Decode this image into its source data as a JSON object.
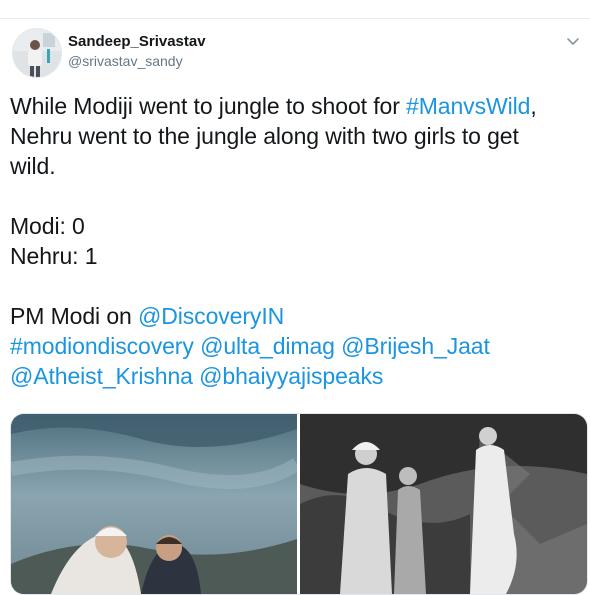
{
  "tweet": {
    "author": {
      "display_name": "Sandeep_Srivastav",
      "handle": "@srivastav_sandy"
    },
    "text": {
      "line1_plain": "While Modiji went to jungle to shoot for ",
      "line1_link": "#ManvsWild",
      "line1_end": ",",
      "line2": "Nehru went to the jungle along with two girls to get",
      "line3": "wild.",
      "line4": "Modi: 0",
      "line5": "Nehru: 1",
      "line6_plain": "PM Modi on ",
      "line6_link": "@DiscoveryIN",
      "line7_link1": "#modiondiscovery",
      "line7_link2": "@ulta_dimag",
      "line7_link3": "@Brijesh_Jaat",
      "line8_link1": "@Atheist_Krishna",
      "line8_link2": "@bhaiyyajispeaks"
    },
    "icons": {
      "more": "chevron-down-icon"
    },
    "colors": {
      "link": "#1b95e0",
      "text": "#14171a",
      "secondary": "#657786"
    }
  }
}
